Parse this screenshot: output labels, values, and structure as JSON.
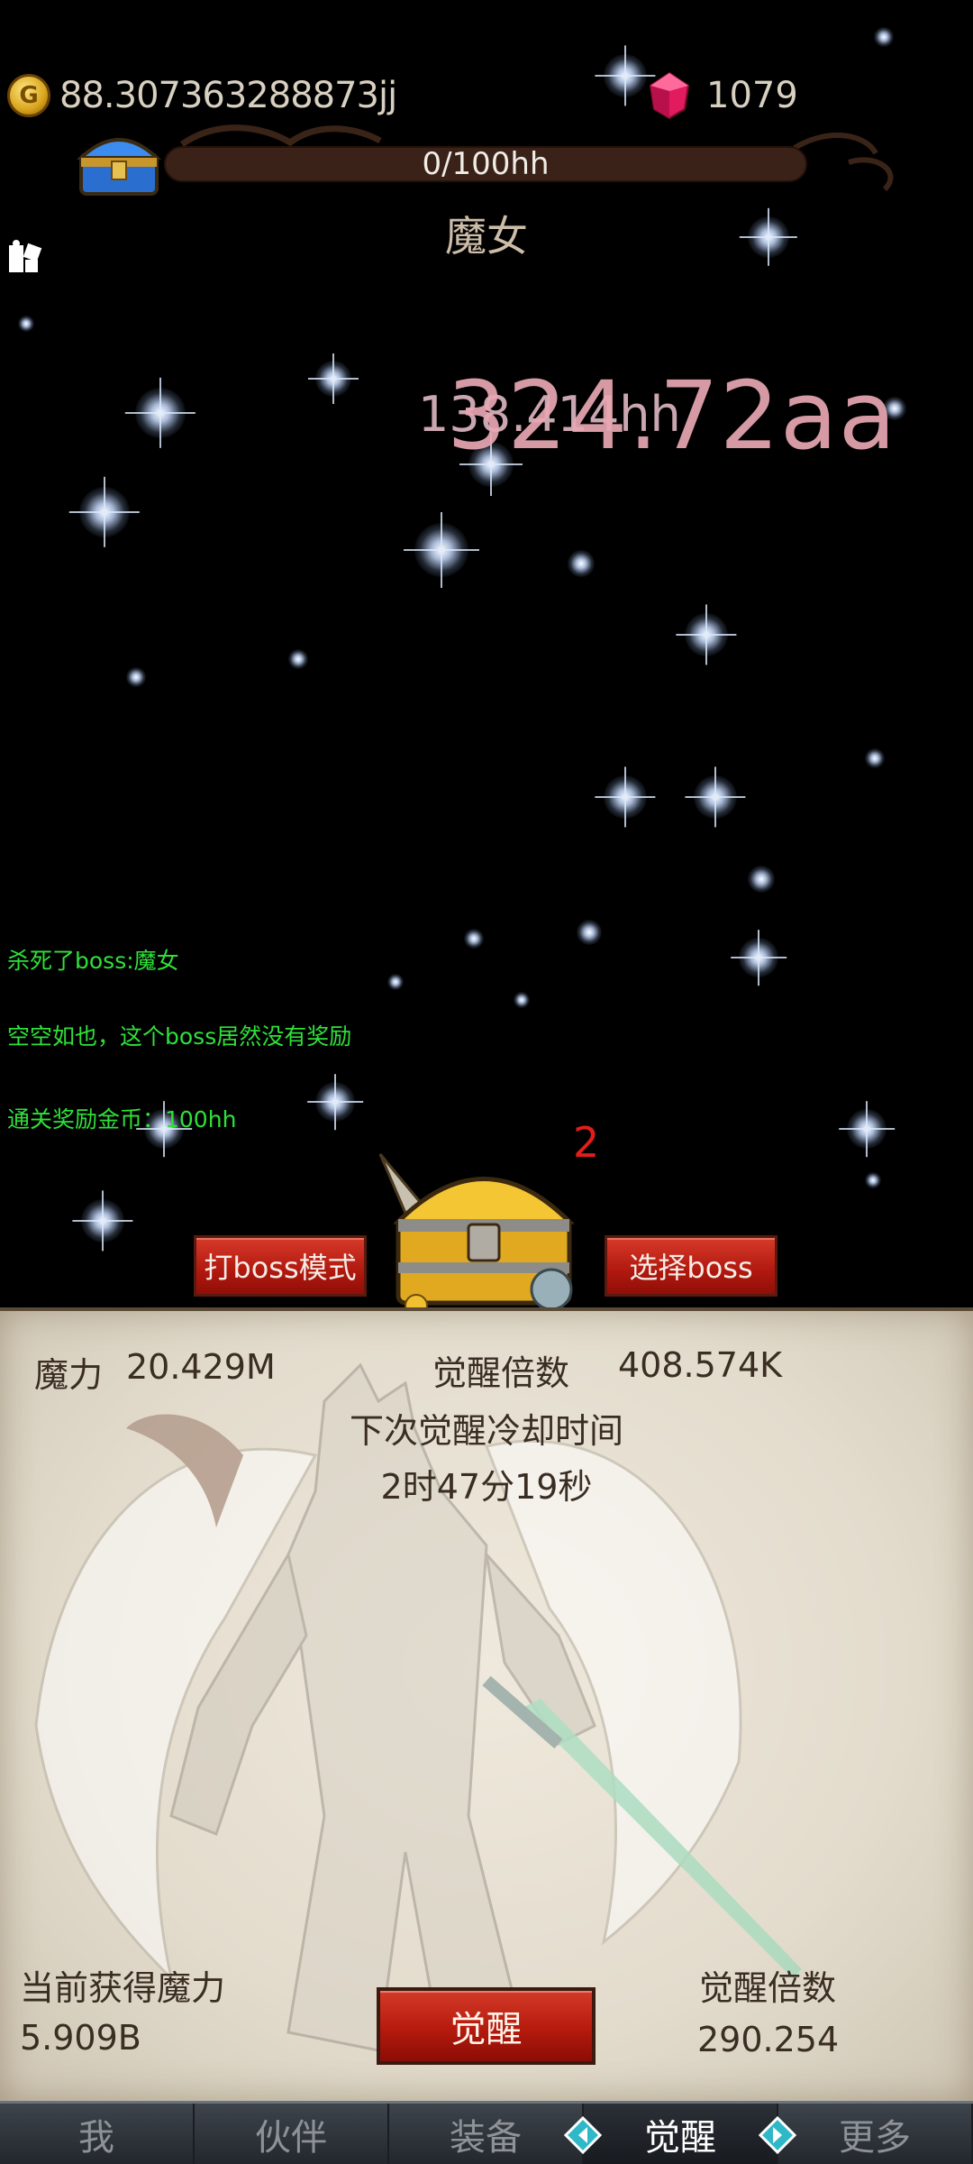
{
  "hud": {
    "coin_icon": "gold-coin-icon",
    "coin_symbol": "G",
    "gold": "88.307363288873jj",
    "gem_icon": "pink-gem-icon",
    "gems": "1079",
    "boss_progress": "0/100hh",
    "boss_name": "魔女"
  },
  "damage": {
    "small": "138.414hh",
    "big": "324.72aa"
  },
  "log": {
    "line1": "杀死了boss:魔女",
    "line2": "空空如也，这个boss居然没有奖励",
    "line3": "通关奖励金币：100hh"
  },
  "battle": {
    "chest_count": "2",
    "boss_mode_label": "打boss模式",
    "select_boss_label": "选择boss"
  },
  "awaken": {
    "magic_label": "魔力",
    "magic_value": "20.429M",
    "multiplier_label": "觉醒倍数",
    "multiplier_value": "408.574K",
    "cooldown_label": "下次觉醒冷却时间",
    "cooldown_value": "2时47分19秒",
    "gain_label": "当前获得魔力",
    "gain_value": "5.909B",
    "next_multiplier_label": "觉醒倍数",
    "next_multiplier_value": "290.254",
    "button_label": "觉醒"
  },
  "nav": {
    "items": [
      "我",
      "伙伴",
      "装备",
      "觉醒",
      "更多"
    ],
    "active": "觉醒"
  },
  "colors": {
    "log_green": "#2fe03a",
    "button_red": "#b51a0d",
    "panel_bg": "#e3dccd",
    "damage_pink": "#e9a8b4",
    "chest_count_red": "#e41c1c"
  }
}
